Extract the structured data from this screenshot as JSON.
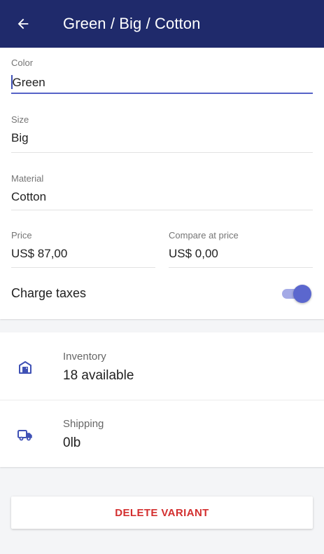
{
  "appbar": {
    "title": "Green / Big / Cotton",
    "back_icon": "arrow-left-icon"
  },
  "form": {
    "color": {
      "label": "Color",
      "value": "Green"
    },
    "size": {
      "label": "Size",
      "value": "Big"
    },
    "material": {
      "label": "Material",
      "value": "Cotton"
    },
    "price": {
      "label": "Price",
      "value": "US$ 87,00"
    },
    "compare_price": {
      "label": "Compare at price",
      "value": "US$ 0,00"
    },
    "charge_taxes": {
      "label": "Charge taxes",
      "enabled": true
    }
  },
  "details": {
    "inventory": {
      "label": "Inventory",
      "value": "18 available",
      "icon": "warehouse-icon"
    },
    "shipping": {
      "label": "Shipping",
      "value": "0lb",
      "icon": "truck-icon"
    }
  },
  "actions": {
    "delete_label": "DELETE VARIANT"
  },
  "colors": {
    "appbar": "#1f2a6b",
    "accent": "#5663c7",
    "danger": "#d32f2f"
  }
}
